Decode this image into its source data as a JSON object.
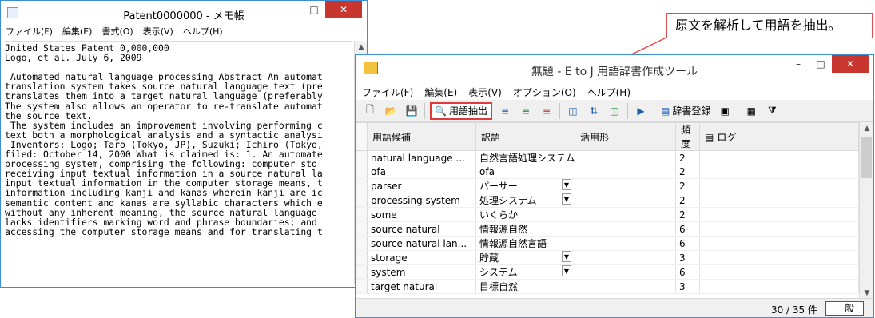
{
  "notepad": {
    "title": "Patent0000000 - メモ帳",
    "menu": [
      "ファイル(F)",
      "編集(E)",
      "書式(O)",
      "表示(V)",
      "ヘルプ(H)"
    ],
    "body_text": "Jnited States Patent 0,000,000\nLogo, et al. July 6, 2009\n\n Automated natural language processing Abstract An automat\ntranslation system takes source natural language text (pre\ntranslates them into a target natural language (preferably\nThe system also allows an operator to re-translate automat\nthe source text.\n The system includes an improvement involving performing c\ntext both a morphological analysis and a syntactic analysi\n Inventors: Logo; Taro (Tokyo, JP), Suzuki; Ichiro (Tokyo,\nfiled: October 14, 2000 What is claimed is: 1. An automate\nprocessing system, comprising the following: computer sto\nreceiving input textual information in a source natural la\ninput textual information in the computer storage means, t\ninformation including kanji and kanas wherein kanji are ic\nsemantic content and kanas are syllabic characters which e\nwithout any inherent meaning, the source natural language\nlacks identifiers marking word and phrase boundaries; and\naccessing the computer storage means and for translating t"
  },
  "callout": {
    "text": "原文を解析して用語を抽出。"
  },
  "tool": {
    "title": "無題 - E to J 用語辞書作成ツール",
    "menu": [
      "ファイル(F)",
      "編集(E)",
      "表示(V)",
      "オプション(O)",
      "ヘルプ(H)"
    ],
    "extract_label": "用語抽出",
    "dict_register_label": "辞書登録",
    "columns": [
      "用語候補",
      "訳語",
      "活用形",
      "頻度",
      "ログ"
    ],
    "rows": [
      {
        "term": "natural language ...",
        "trans": "自然言語処理システム",
        "form": "",
        "freq": "2",
        "dd": false
      },
      {
        "term": "ofa",
        "trans": "ofa",
        "form": "",
        "freq": "2",
        "dd": false
      },
      {
        "term": "parser",
        "trans": "パーサー",
        "form": "",
        "freq": "2",
        "dd": true
      },
      {
        "term": "processing system",
        "trans": "処理システム",
        "form": "",
        "freq": "2",
        "dd": true
      },
      {
        "term": "some",
        "trans": "いくらか",
        "form": "",
        "freq": "2",
        "dd": false
      },
      {
        "term": "source natural",
        "trans": "情報源自然",
        "form": "",
        "freq": "6",
        "dd": false
      },
      {
        "term": "source natural lan...",
        "trans": "情報源自然言語",
        "form": "",
        "freq": "6",
        "dd": false
      },
      {
        "term": "storage",
        "trans": "貯蔵",
        "form": "",
        "freq": "3",
        "dd": true
      },
      {
        "term": "system",
        "trans": "システム",
        "form": "",
        "freq": "6",
        "dd": true
      },
      {
        "term": "target natural",
        "trans": "目標自然",
        "form": "",
        "freq": "3",
        "dd": false
      }
    ],
    "status_count": "30 / 35 件",
    "mode_label": "一般"
  },
  "colors": {
    "highlight": "#e03a3a",
    "window_border": "#3b8fd9",
    "close_button": "#c7372f"
  }
}
